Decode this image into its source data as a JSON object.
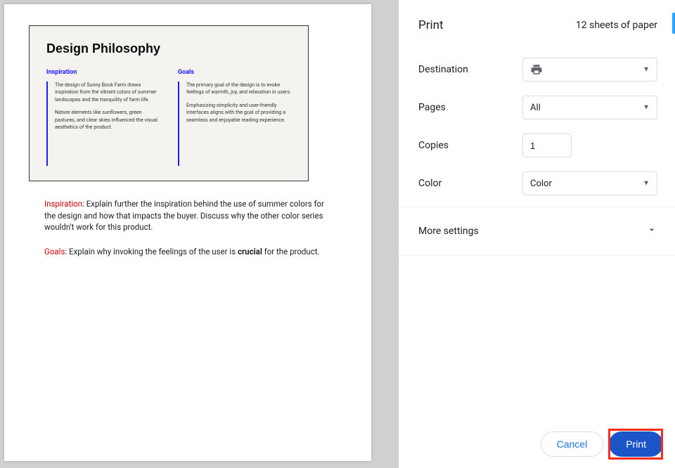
{
  "preview": {
    "doc_title": "Design Philosophy",
    "columns": [
      {
        "heading": "Inspiration",
        "paragraphs": [
          "The design of Sunny Book Farm draws inspiration from the vibrant colors of summer landscapes and the tranquility of farm life.",
          "Nature elements like sunflowers, green pastures, and clear skies influenced the visual aesthetics of the product."
        ]
      },
      {
        "heading": "Goals",
        "paragraphs": [
          "The primary goal of the design is to evoke feelings of warmth, joy, and relaxation in users.",
          "Emphasizing simplicity and user-friendly interfaces aligns with the goal of providing a seamless and enjoyable reading experience."
        ]
      }
    ],
    "comments": [
      {
        "tag": "Inspiration",
        "text": ": Explain further the inspiration behind the use of summer colors for the design and how that impacts the buyer. Discuss why the other color series wouldn't work for this product."
      },
      {
        "tag": "Goals",
        "text_pre": ": Explain why invoking the feelings of the user is ",
        "bold": "crucial",
        "text_post": " for the product."
      }
    ]
  },
  "panel": {
    "title": "Print",
    "sheet_count": "12 sheets of paper",
    "labels": {
      "destination": "Destination",
      "pages": "Pages",
      "copies": "Copies",
      "color": "Color",
      "more": "More settings",
      "cancel": "Cancel",
      "print": "Print"
    },
    "values": {
      "destination": "",
      "pages": "All",
      "copies": "1",
      "color": "Color"
    }
  }
}
